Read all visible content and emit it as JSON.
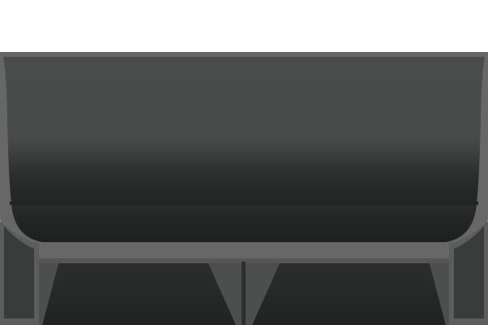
{
  "scene": {
    "description_visible_text": [],
    "colors": {
      "background": "#ffffff",
      "frame_outline": "#666766",
      "panel_top": "#4a4c4b",
      "panel_mid": "#3c3e3d",
      "panel_dark": "#262727",
      "panel_darkest": "#1f2020",
      "foot_fill": "#2a2b2b",
      "side_panel": "#3a3b3b",
      "divider": "#303131"
    },
    "icons": [
      "sofa-shape"
    ]
  }
}
